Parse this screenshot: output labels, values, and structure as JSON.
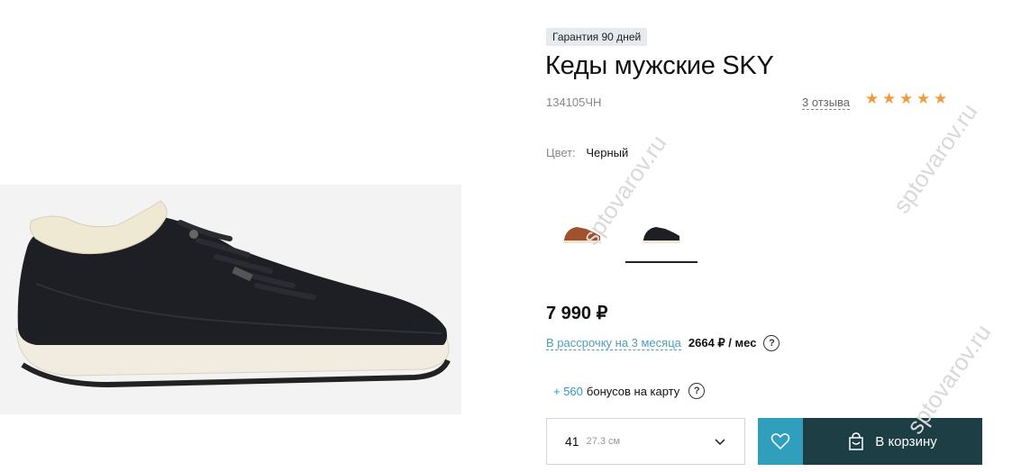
{
  "product": {
    "badge": "Гарантия 90 дней",
    "title": "Кеды мужские SKY",
    "sku": "134105ЧН",
    "reviews_label": "3 отзыва",
    "rating": 5,
    "rating_max": 5
  },
  "color": {
    "label": "Цвет:",
    "value": "Черный",
    "swatches": [
      {
        "name": "brown-sneaker",
        "color": "#a0522d",
        "selected": false
      },
      {
        "name": "black-sneaker",
        "color": "#222222",
        "selected": true
      }
    ]
  },
  "price": {
    "value": "7 990 ₽",
    "installment_link": "В рассрочку на 3 месяца",
    "installment_amount": "2664 ₽ / мес",
    "help": "?"
  },
  "bonus": {
    "plus": "+ 560",
    "text": "бонусов на карту",
    "help": "?"
  },
  "size": {
    "number": "41",
    "cm": "27.3 см"
  },
  "cart": {
    "label": "В корзину"
  },
  "watermark": "sptovarov.ru",
  "colors": {
    "accent": "#2f9fbc",
    "cart_bg": "#1d3e44",
    "star": "#f39a3a",
    "link": "#4a9ec0"
  }
}
